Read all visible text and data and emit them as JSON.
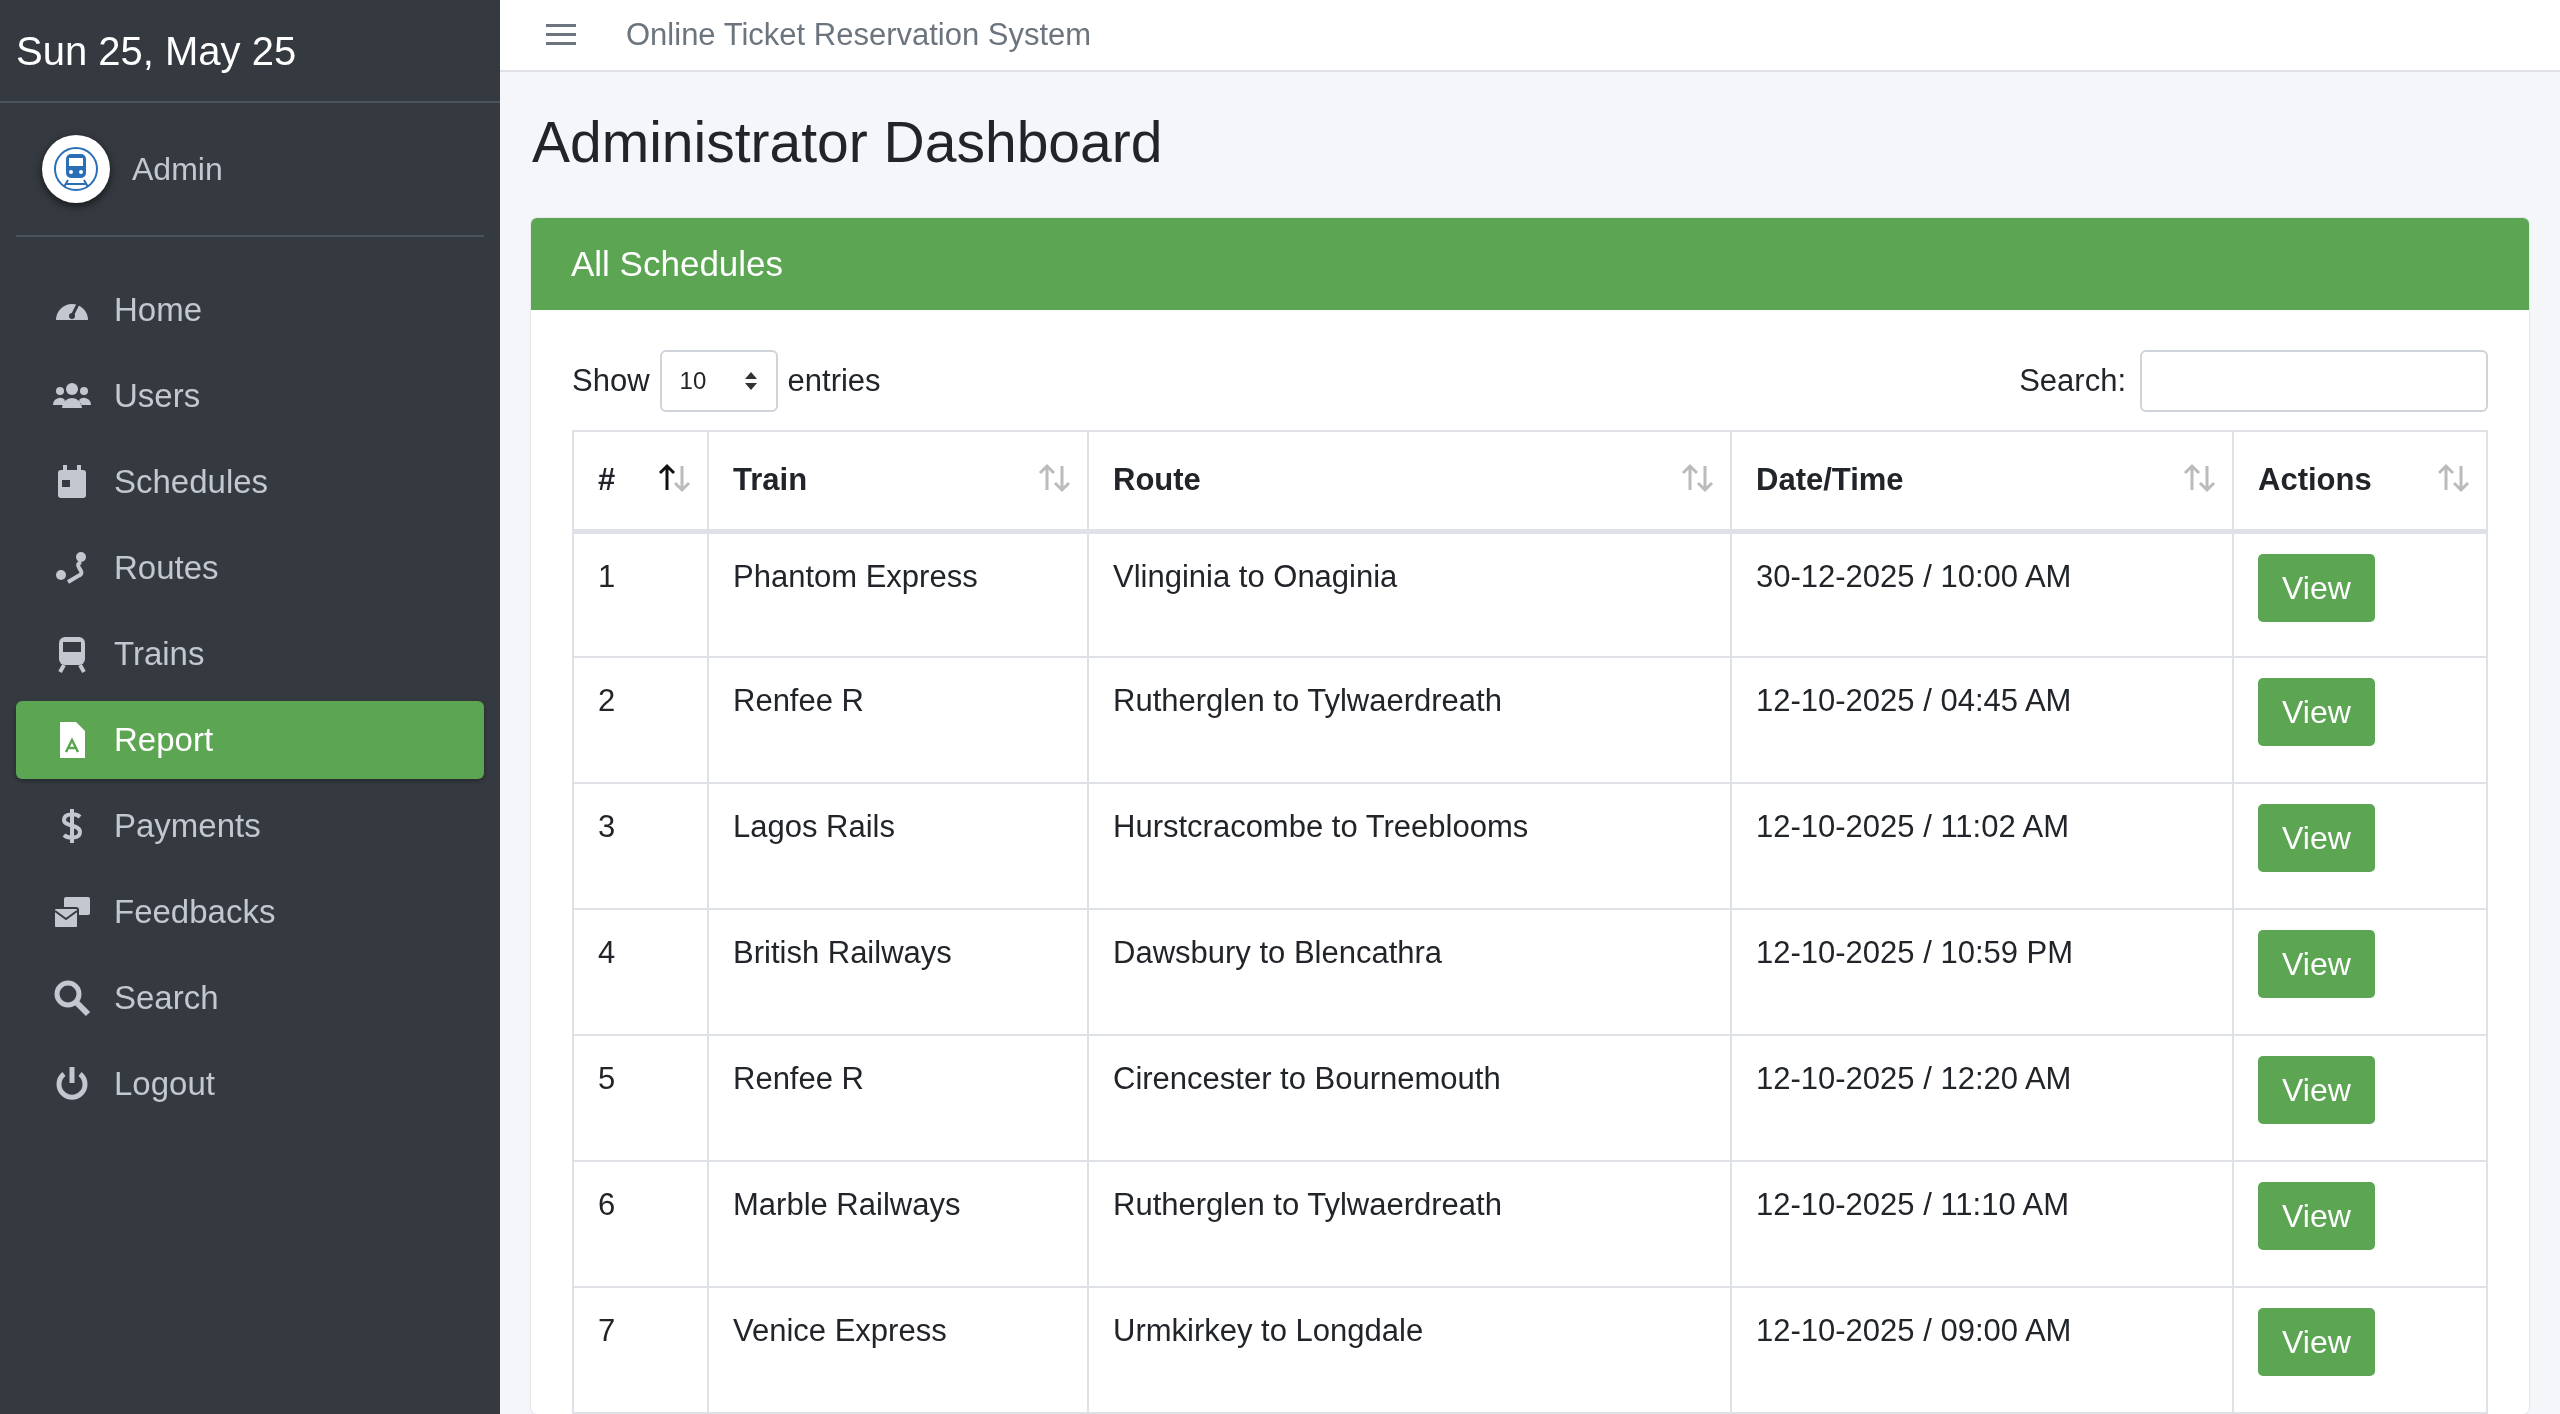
{
  "sidebar": {
    "date": "Sun 25, May 25",
    "user": "Admin",
    "items": [
      {
        "label": "Home",
        "selected": false
      },
      {
        "label": "Users",
        "selected": false
      },
      {
        "label": "Schedules",
        "selected": false
      },
      {
        "label": "Routes",
        "selected": false
      },
      {
        "label": "Trains",
        "selected": false
      },
      {
        "label": "Report",
        "selected": true
      },
      {
        "label": "Payments",
        "selected": false
      },
      {
        "label": "Feedbacks",
        "selected": false
      },
      {
        "label": "Search",
        "selected": false
      },
      {
        "label": "Logout",
        "selected": false
      }
    ]
  },
  "topbar": {
    "title": "Online Ticket Reservation System"
  },
  "page_title": "Administrator Dashboard",
  "card": {
    "title": "All Schedules",
    "show_label": "Show",
    "page_size": "10",
    "entries_label": "entries",
    "search_label": "Search:",
    "table": {
      "columns": [
        {
          "label": "#",
          "sorted": true
        },
        {
          "label": "Train",
          "sorted": false
        },
        {
          "label": "Route",
          "sorted": false
        },
        {
          "label": "Date/Time",
          "sorted": false
        },
        {
          "label": "Actions",
          "sorted": false
        }
      ],
      "rows": [
        {
          "cells": [
            "1",
            "Phantom Express",
            "Vlinginia to Onaginia",
            "30-12-2025 / 10:00 AM"
          ],
          "action": "View"
        },
        {
          "cells": [
            "2",
            "Renfee R",
            "Rutherglen to Tylwaerdreath",
            "12-10-2025 / 04:45 AM"
          ],
          "action": "View"
        },
        {
          "cells": [
            "3",
            "Lagos Rails",
            "Hurstcracombe to Treeblooms",
            "12-10-2025 / 11:02 AM"
          ],
          "action": "View"
        },
        {
          "cells": [
            "4",
            "British Railways",
            "Dawsbury to Blencathra",
            "12-10-2025 / 10:59 PM"
          ],
          "action": "View"
        },
        {
          "cells": [
            "5",
            "Renfee R",
            "Cirencester to Bournemouth",
            "12-10-2025 / 12:20 AM"
          ],
          "action": "View"
        },
        {
          "cells": [
            "6",
            "Marble Railways",
            "Rutherglen to Tylwaerdreath",
            "12-10-2025 / 11:10 AM"
          ],
          "action": "View"
        },
        {
          "cells": [
            "7",
            "Venice Express",
            "Urmkirkey to Longdale",
            "12-10-2025 / 09:00 AM"
          ],
          "action": "View"
        }
      ]
    }
  }
}
